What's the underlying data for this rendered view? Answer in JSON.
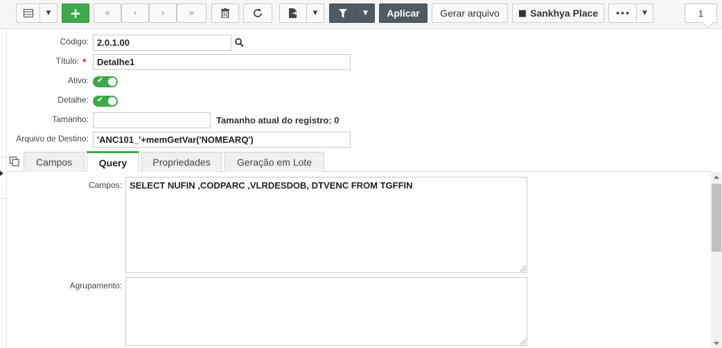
{
  "toolbar": {
    "add_label": "+",
    "apply_label": "Aplicar",
    "generate_label": "Gerar arquivo",
    "place_label": "Sankhya Place",
    "more_label": "•••",
    "page_number": "1"
  },
  "form": {
    "codigo_label": "Código:",
    "codigo_value": "2.0.1.00",
    "titulo_label": "Título:",
    "titulo_required": "*",
    "titulo_value": "Detalhe1",
    "ativo_label": "Ativo:",
    "ativo_on": true,
    "detalhe_label": "Detalhe:",
    "detalhe_on": true,
    "tamanho_label": "Tamanho:",
    "tamanho_value": "",
    "tamanho_info": "Tamanho atual do registro: 0",
    "destino_label": "Arquivo de Destino:",
    "destino_value": "'ANC101_'+memGetVar('NOMEARQ')"
  },
  "tabs": [
    {
      "label": "Campos",
      "active": false
    },
    {
      "label": "Query",
      "active": true
    },
    {
      "label": "Propriedades",
      "active": false
    },
    {
      "label": "Geração em Lote",
      "active": false
    }
  ],
  "query": {
    "campos_label": "Campos:",
    "campos_value": "SELECT NUFIN ,CODPARC ,VLRDESDOB, DTVENC FROM TGFFIN",
    "agrupamento_label": "Agrupamento:",
    "agrupamento_value": ""
  },
  "colors": {
    "accent_green": "#3fa84a",
    "dark_button": "#505a63",
    "required": "#d9262b"
  },
  "icons": [
    "grid-icon",
    "plus-icon",
    "first-page-icon",
    "prev-icon",
    "next-icon",
    "last-page-icon",
    "trash-icon",
    "refresh-icon",
    "export-icon",
    "filter-icon",
    "bag-icon",
    "search-icon",
    "copy-icon"
  ]
}
